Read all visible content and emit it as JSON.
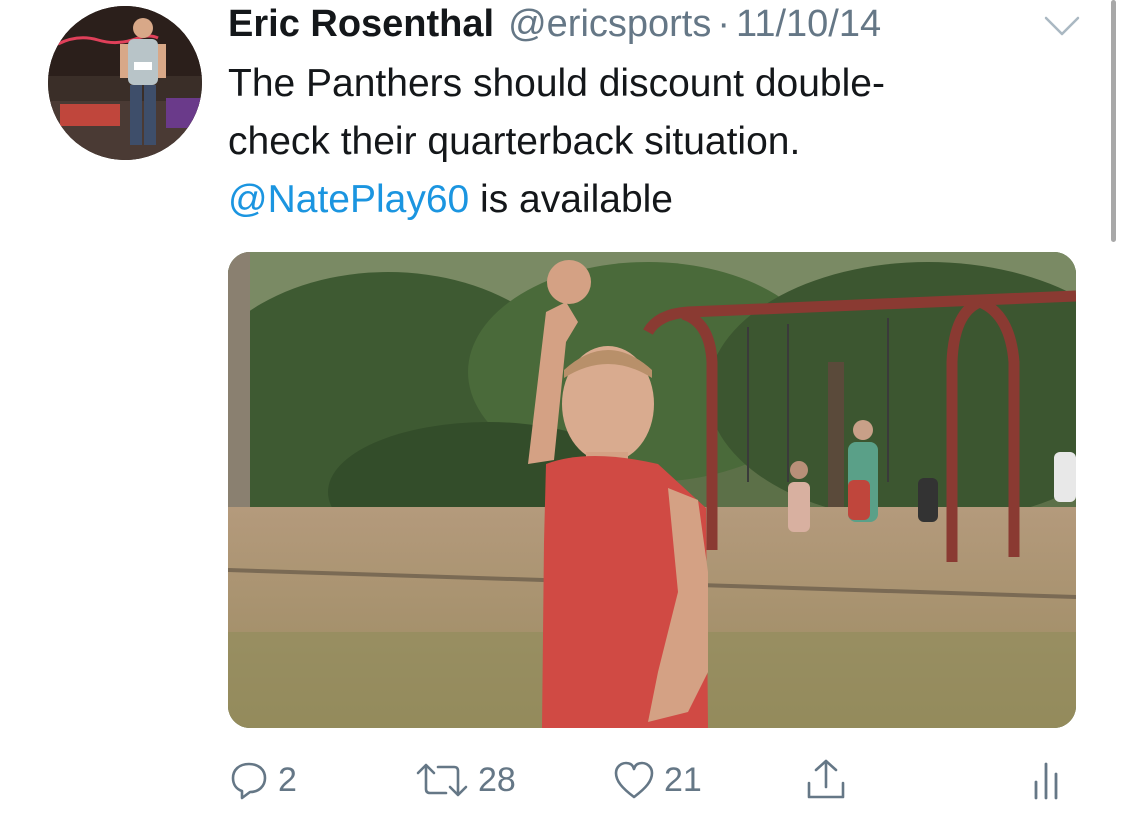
{
  "tweet": {
    "author_name": "Eric Rosenthal",
    "handle": "@ericsports",
    "separator": "·",
    "date": "11/10/14",
    "text_line1": "The Panthers should discount double-",
    "text_line2": "check their quarterback situation.",
    "mention": "@NatePlay60",
    "text_line3_rest": " is available",
    "media": {
      "type": "animated-gif-thumbnail",
      "description_icons": [
        "playground",
        "swing-set",
        "child-raising-fist"
      ]
    }
  },
  "actions": {
    "reply": {
      "icon": "reply-icon",
      "count": "2"
    },
    "retweet": {
      "icon": "retweet-icon",
      "count": "28"
    },
    "like": {
      "icon": "heart-icon",
      "count": "21"
    },
    "share": {
      "icon": "share-icon"
    },
    "analytics": {
      "icon": "analytics-icon"
    }
  },
  "colors": {
    "text": "#14171a",
    "secondary": "#657786",
    "link": "#1b95e0",
    "background": "#ffffff"
  }
}
